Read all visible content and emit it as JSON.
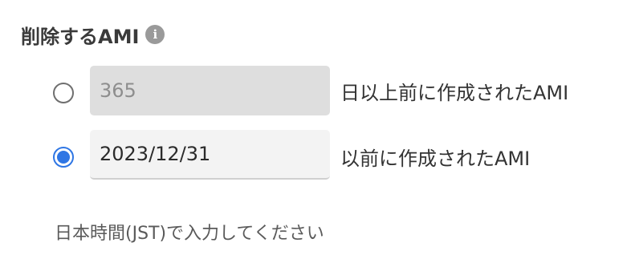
{
  "section": {
    "title": "削除するAMI",
    "info_icon": "info-circle-icon",
    "info_glyph": "i"
  },
  "options": [
    {
      "selected": false,
      "input_value": "",
      "input_placeholder": "365",
      "input_disabled": true,
      "label": "日以上前に作成されたAMI"
    },
    {
      "selected": true,
      "input_value": "2023/12/31",
      "input_placeholder": "",
      "input_disabled": false,
      "label": "以前に作成されたAMI"
    }
  ],
  "hint": "日本時間(JST)で入力してください",
  "colors": {
    "accent": "#2f76e4",
    "disabled_bg": "#dedede",
    "field_bg": "#f3f3f3",
    "icon_bg": "#9a9a9a"
  }
}
